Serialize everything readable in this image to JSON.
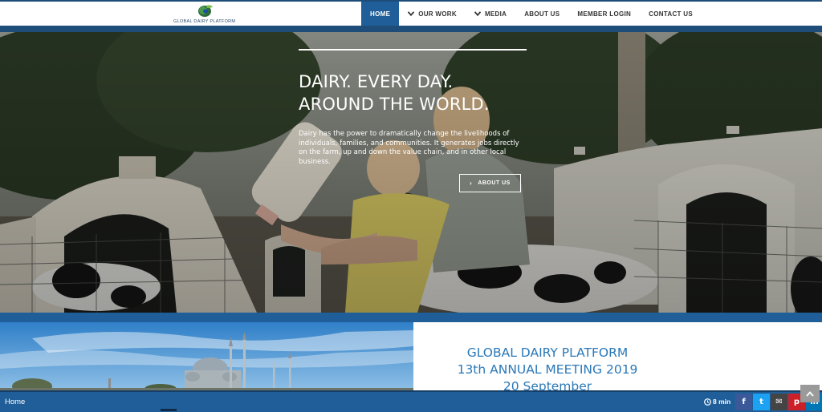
{
  "header": {
    "logo_text": "GLOBAL DAIRY PLATFORM",
    "nav": [
      {
        "label": "HOME",
        "active": true,
        "has_dropdown": false
      },
      {
        "label": "OUR WORK",
        "active": false,
        "has_dropdown": true
      },
      {
        "label": "MEDIA",
        "active": false,
        "has_dropdown": true
      },
      {
        "label": "ABOUT US",
        "active": false,
        "has_dropdown": false
      },
      {
        "label": "MEMBER LOGIN",
        "active": false,
        "has_dropdown": false
      },
      {
        "label": "CONTACT US",
        "active": false,
        "has_dropdown": false
      }
    ]
  },
  "hero": {
    "title_line1": "DAIRY. EVERY DAY.",
    "title_line2": "AROUND THE WORLD.",
    "body_line1": "Dairy has the power to dramatically change the livelihoods of",
    "body_line2": "individuals, families, and communities. It generates jobs directly",
    "body_line3": "on the farm, up and down the value chain, and in other local business.",
    "button_label": "ABOUT US"
  },
  "meeting": {
    "line1": "GLOBAL DAIRY PLATFORM",
    "line2": "13th ANNUAL MEETING 2019",
    "line3": "20 September"
  },
  "footer": {
    "home_label": "Home",
    "read_time": "8 min",
    "share_buttons": [
      {
        "icon": "facebook-icon",
        "glyph": "f",
        "color": "#3b5998"
      },
      {
        "icon": "twitter-icon",
        "glyph": "t",
        "color": "#1da1f2"
      },
      {
        "icon": "email-icon",
        "glyph": "✉",
        "color": "#444444"
      },
      {
        "icon": "pinterest-icon",
        "glyph": "p",
        "color": "#cb2027"
      },
      {
        "icon": "linkedin-icon",
        "glyph": "in",
        "color": "#0077b5"
      }
    ]
  },
  "colors": {
    "brand_blue": "#1f5e98",
    "dark_blue": "#1f4d7a",
    "meeting_text": "#2a78b8"
  }
}
